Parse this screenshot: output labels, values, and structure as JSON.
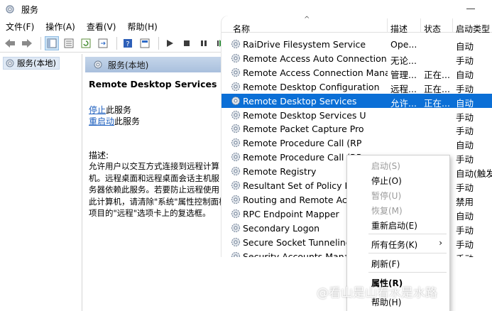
{
  "window": {
    "title": "服务"
  },
  "menu": [
    "文件(F)",
    "操作(A)",
    "查看(V)",
    "帮助(H)"
  ],
  "toolbar_icons": [
    "back-arrow-icon",
    "forward-arrow-icon",
    "console-tree-icon",
    "properties-icon",
    "refresh-icon",
    "export-list-icon",
    "help-icon",
    "mmc-icon",
    "play-icon",
    "stop-icon",
    "pause-icon",
    "restart-icon"
  ],
  "left_tree": {
    "node_label": "服务(本地)"
  },
  "right_header": {
    "label": "服务(本地)"
  },
  "detail": {
    "service_title": "Remote Desktop Services",
    "stop_link": "停止",
    "stop_suffix": "此服务",
    "restart_link": "重启动",
    "restart_suffix": "此服务",
    "desc_label": "描述:",
    "desc_lines": [
      "允许用户以交互方式连接到远程计算",
      "机。远程桌面和远程桌面会话主机服",
      "务器依赖此服务。若要防止远程使用",
      "此计算机，请清除\"系统\"属性控制面板",
      "项目的\"远程\"选项卡上的复选框。"
    ]
  },
  "columns": {
    "name": "名称",
    "description": "描述",
    "status": "状态",
    "startup": "启动类型"
  },
  "services": [
    {
      "name": "RaiDrive Filesystem Service",
      "desc": "Ope...",
      "status": "",
      "startup": "自动"
    },
    {
      "name": "Remote Access Auto Connection ...",
      "desc": "无论...",
      "status": "",
      "startup": "手动"
    },
    {
      "name": "Remote Access Connection Manag...",
      "desc": "管理...",
      "status": "正在...",
      "startup": "自动"
    },
    {
      "name": "Remote Desktop Configuration",
      "desc": "远程...",
      "status": "正在...",
      "startup": "手动"
    },
    {
      "name": "Remote Desktop Services",
      "desc": "允许...",
      "status": "正在...",
      "startup": "自动"
    },
    {
      "name": "Remote Desktop Services U",
      "desc": "",
      "status": "",
      "startup": "手动"
    },
    {
      "name": "Remote Packet Capture Pro",
      "desc": "",
      "status": "",
      "startup": "手动"
    },
    {
      "name": "Remote Procedure Call (RP",
      "desc": "",
      "status": "",
      "startup": "自动"
    },
    {
      "name": "Remote Procedure Call (RP",
      "desc": "",
      "status": "",
      "startup": "手动"
    },
    {
      "name": "Remote Registry",
      "desc": "",
      "status": "",
      "startup": "自动(触发"
    },
    {
      "name": "Resultant Set of Policy Prov",
      "desc": "",
      "status": "",
      "startup": "手动"
    },
    {
      "name": "Routing and Remote Access",
      "desc": "",
      "status": "",
      "startup": "禁用"
    },
    {
      "name": "RPC Endpoint Mapper",
      "desc": "",
      "status": "",
      "startup": "自动"
    },
    {
      "name": "Secondary Logon",
      "desc": "",
      "status": "",
      "startup": "手动"
    },
    {
      "name": "Secure Socket Tunneling",
      "desc": "",
      "status": "",
      "startup": "手动"
    },
    {
      "name": "Security Accounts Manage",
      "desc": "",
      "status": "",
      "startup": "手动"
    }
  ],
  "context_menu": {
    "start": "启动(S)",
    "stop": "停止(O)",
    "pause": "暂停(U)",
    "resume": "恢复(M)",
    "restart": "重新启动(E)",
    "all_tasks": "所有任务(K)",
    "refresh": "刷新(F)",
    "properties": "属性(R)",
    "help": "帮助(H)"
  },
  "watermark": "@看山是山看水是水路",
  "colors": {
    "selection": "#0b6fd6",
    "header_gradient": "#b6cbe3",
    "link": "#1d5fbf"
  }
}
